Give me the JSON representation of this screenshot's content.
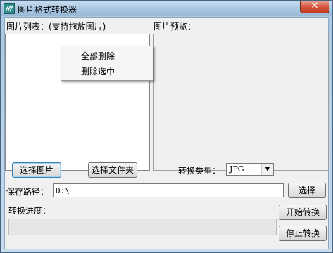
{
  "window": {
    "title": "图片格式转换器",
    "close_label": "✕"
  },
  "left_panel": {
    "label": "图片列表：(支持拖放图片)"
  },
  "right_panel": {
    "label": "图片预览："
  },
  "context_menu": {
    "items": [
      "全部删除",
      "删除选中"
    ]
  },
  "buttons": {
    "select_image": "选择图片",
    "select_folder": "选择文件夹",
    "choose": "选择",
    "start_convert": "开始转换",
    "stop_convert": "停止转换"
  },
  "convert_type": {
    "label": "转换类型：",
    "selected": "JPG"
  },
  "save_path": {
    "label": "保存路径：",
    "value": "D:\\"
  },
  "progress": {
    "label": "转换进度：",
    "value": 0
  },
  "colors": {
    "titlebar": "#a8c6e1",
    "close": "#c23b22",
    "progress_fill": "#06b025"
  }
}
